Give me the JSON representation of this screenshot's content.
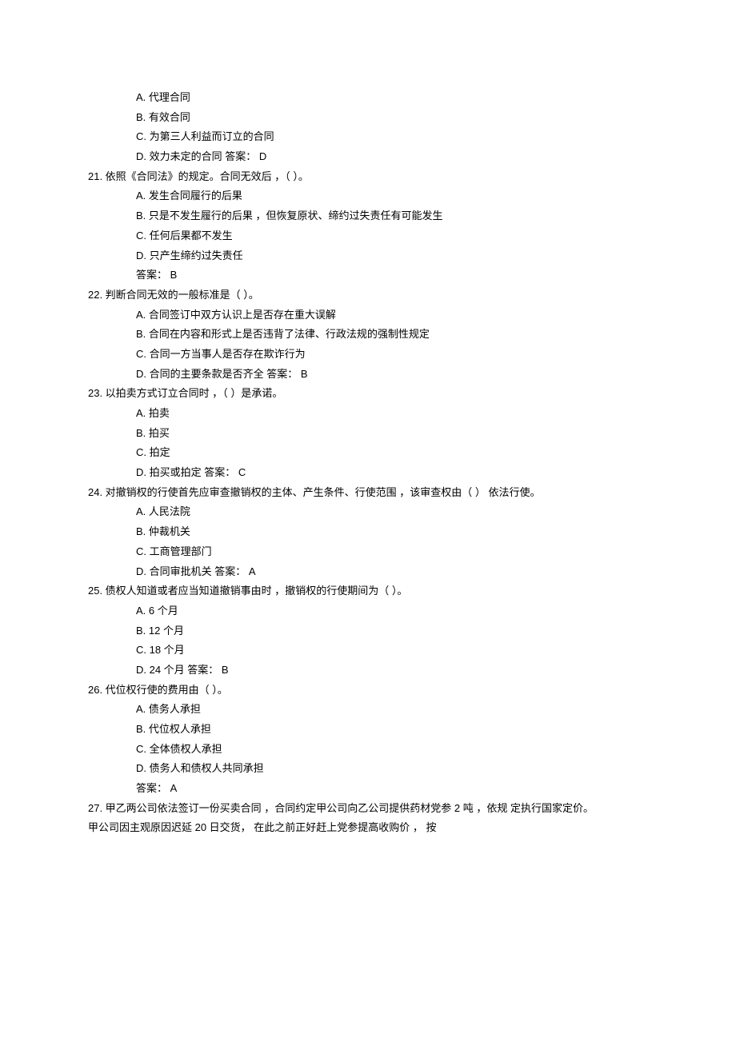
{
  "top_options": {
    "a": "A.  代理合同",
    "b": "B.  有效合同",
    "c": "C.  为第三人利益而订立的合同",
    "d": "D.  效力未定的合同 答案：  D"
  },
  "q21": {
    "stem": "21.  依照《合同法》的规定。合同无效后 ，（  ）。",
    "a": "A.  发生合同履行的后果",
    "b": "B.  只是不发生履行的后果 ，但恢复原状、缔约过失责任有可能发生",
    "c": "C.  任何后果都不发生",
    "d": "D.  只产生缔约过失责任",
    "ans": "答案：  B"
  },
  "q22": {
    "stem": "22.  判断合同无效的一般标准是（  ）。",
    "a": "A.  合同签订中双方认识上是否存在重大误解",
    "b": "B.  合同在内容和形式上是否违背了法律、行政法规的强制性规定",
    "c": "C.  合同一方当事人是否存在欺诈行为",
    "d": "D.  合同的主要条款是否齐全 答案：  B"
  },
  "q23": {
    "stem": "23.  以拍卖方式订立合同时 ，（  ）是承诺。",
    "a": "A.  拍卖",
    "b": "B.  拍买",
    "c": "C.  拍定",
    "d": "D.  拍买或拍定 答案：  C"
  },
  "q24": {
    "stem": "24.  对撤销权的行使首先应审查撤销权的主体、产生条件、行使范围 ，该审查权由（  ） 依法行使。",
    "a": "A.  人民法院",
    "b": "B.  仲裁机关",
    "c": "C.  工商管理部门",
    "d": "D.  合同审批机关 答案：  A"
  },
  "q25": {
    "stem": "25.  债权人知道或者应当知道撤销事由时 ，撤销权的行使期间为（  ）。",
    "a": "A.  6 个月",
    "b": "B.  12 个月",
    "c": "C.  18 个月",
    "d": "D.  24 个月 答案：  B"
  },
  "q26": {
    "stem": "26.  代位权行使的费用由（  ）。",
    "a": "A.  债务人承担",
    "b": "B.  代位权人承担",
    "c": "C.  全体债权人承担",
    "d": "D.  债务人和债权人共同承担",
    "ans": "答案：  A"
  },
  "q27": {
    "line1": "27.  甲乙两公司依法签订一份买卖合同 ，合同约定甲公司向乙公司提供药材党参 2 吨 ，依规 定执行国家定价。",
    "line2": "甲公司因主观原因迟延 20 日交货， 在此之前正好赶上党参提高收购价 ， 按"
  }
}
